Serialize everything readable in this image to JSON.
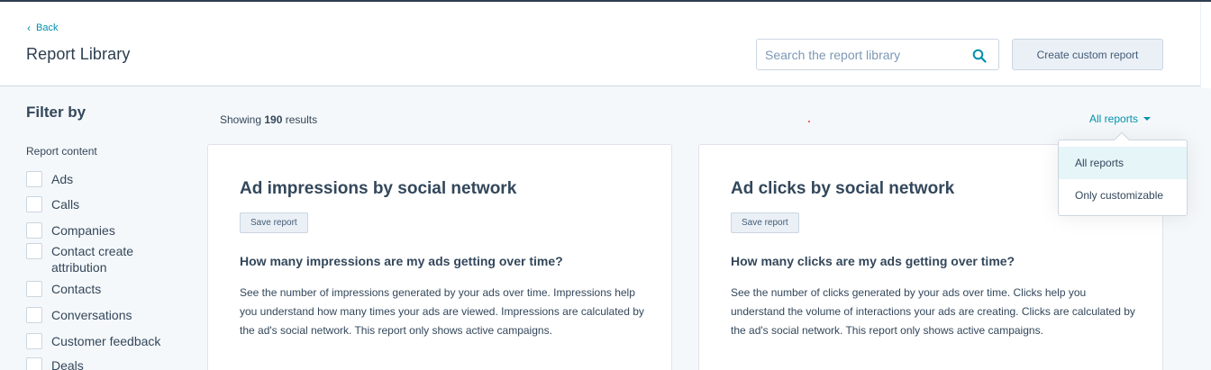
{
  "header": {
    "back_label": "Back",
    "title": "Report Library",
    "search_placeholder": "Search the report library",
    "create_label": "Create custom report"
  },
  "sidebar": {
    "title": "Filter by",
    "group_label": "Report content",
    "options": [
      "Ads",
      "Calls",
      "Companies",
      "Contact create attribution",
      "Contacts",
      "Conversations",
      "Customer feedback",
      "Deals"
    ]
  },
  "results": {
    "prefix": "Showing",
    "count": "190",
    "suffix": "results"
  },
  "filter_dropdown": {
    "selected": "All reports",
    "options": [
      "All reports",
      "Only customizable"
    ]
  },
  "cards": [
    {
      "title": "Ad impressions by social network",
      "save_label": "Save report",
      "question": "How many impressions are my ads getting over time?",
      "description": "See the number of impressions generated by your ads over time. Impressions help you understand how many times your ads are viewed. Impressions are calculated by the ad's social network. This report only shows active campaigns."
    },
    {
      "title": "Ad clicks by social network",
      "save_label": "Save report",
      "question": "How many clicks are my ads getting over time?",
      "description": "See the number of clicks generated by your ads over time. Clicks help you understand the volume of interactions your ads are creating. Clicks are calculated by the ad's social network. This report only shows active campaigns."
    }
  ],
  "colors": {
    "accent": "#0091ae",
    "text": "#33475b",
    "border": "#cbd6e2",
    "background": "#f5f8fa"
  }
}
